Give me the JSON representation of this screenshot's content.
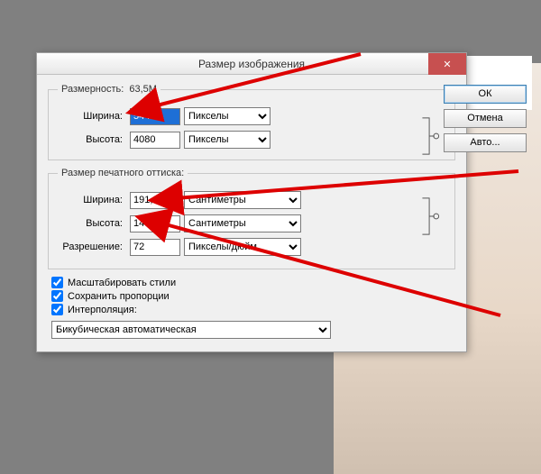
{
  "titlebar": {
    "title": "Размер изображения"
  },
  "buttons": {
    "ok": "ОК",
    "cancel": "Отмена",
    "auto": "Авто..."
  },
  "close_icon": "✕",
  "pixel_group": {
    "legend": "Размерность:",
    "size_label": "63,5M",
    "width_label": "Ширина:",
    "width_value": "5440",
    "width_unit": "Пикселы",
    "height_label": "Высота:",
    "height_value": "4080",
    "height_unit": "Пикселы"
  },
  "print_group": {
    "legend": "Размер печатного оттиска:",
    "width_label": "Ширина:",
    "width_value": "191,91",
    "width_unit": "Сантиметры",
    "height_label": "Высота:",
    "height_value": "143,93",
    "height_unit": "Сантиметры",
    "res_label": "Разрешение:",
    "res_value": "72",
    "res_unit": "Пикселы/дюйм"
  },
  "checks": {
    "scale_styles": "Масштабировать стили",
    "constrain": "Сохранить пропорции",
    "resample": "Интерполяция:"
  },
  "interp_method": "Бикубическая автоматическая"
}
